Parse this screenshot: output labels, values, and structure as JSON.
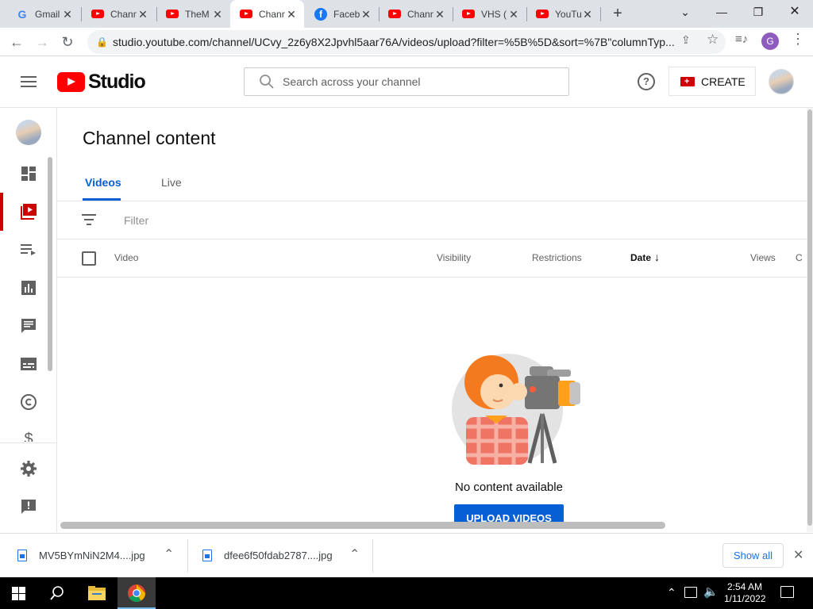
{
  "browser": {
    "tabs": [
      {
        "title": "Gmail",
        "icon": "gmail-icon"
      },
      {
        "title": "Chann",
        "icon": "youtube-icon"
      },
      {
        "title": "TheM",
        "icon": "youtube-icon"
      },
      {
        "title": "Chann",
        "icon": "youtube-icon",
        "active": true
      },
      {
        "title": "Faceb",
        "icon": "facebook-icon"
      },
      {
        "title": "Chann",
        "icon": "youtube-icon"
      },
      {
        "title": "VHS (",
        "icon": "youtube-icon"
      },
      {
        "title": "YouTu",
        "icon": "youtube-icon"
      }
    ],
    "url": "studio.youtube.com/channel/UCvy_2z6y8X2Jpvhl5aar76A/videos/upload?filter=%5B%5D&sort=%7B\"columnTyp...",
    "profile_initial": "G"
  },
  "studio": {
    "logo_text": "Studio",
    "search_placeholder": "Search across your channel",
    "create_label": "CREATE"
  },
  "content": {
    "title": "Channel content",
    "tabs": [
      "Videos",
      "Live"
    ],
    "filter_placeholder": "Filter",
    "columns": {
      "video": "Video",
      "visibility": "Visibility",
      "restrictions": "Restrictions",
      "date": "Date",
      "views": "Views",
      "comments": "C"
    },
    "empty_message": "No content available",
    "upload_label": "UPLOAD VIDEOS"
  },
  "downloads": {
    "items": [
      "MV5BYmNiN2M4....jpg",
      "dfee6f50fdab2787....jpg"
    ],
    "show_all": "Show all"
  },
  "taskbar": {
    "time": "2:54 AM",
    "date": "1/11/2022"
  },
  "colors": {
    "brand_red": "#ff0000",
    "active_blue": "#065fd4",
    "upload_blue": "#065fd4"
  }
}
